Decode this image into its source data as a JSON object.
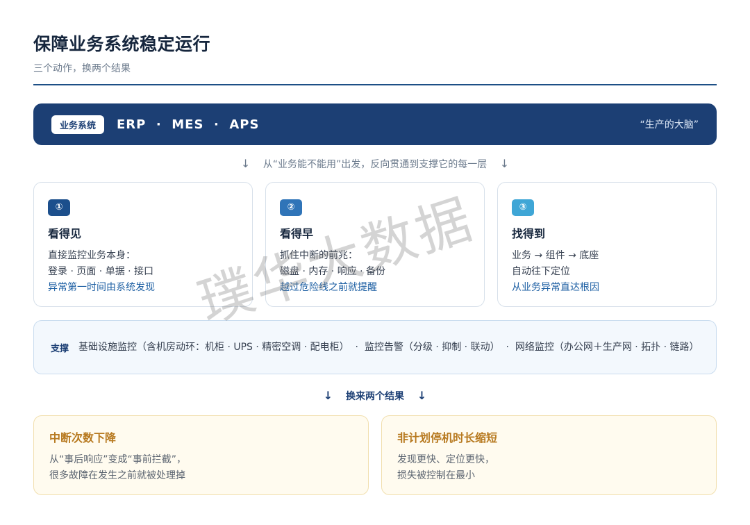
{
  "header": {
    "title": "保障业务系统稳定运行",
    "subtitle": "三个动作，换两个结果"
  },
  "banner": {
    "tag": "业务系统",
    "systems": "ERP  ·  MES  ·  APS",
    "quote": "“生产的大脑”"
  },
  "flow_top": {
    "arrow_left": "↓",
    "text": "从“业务能不能用”出发，反向贯通到支撑它的每一层",
    "arrow_right": "↓"
  },
  "cards": [
    {
      "badge": "①",
      "badge_color": "#1c4f8c",
      "title": "看得见",
      "line1": "直接监控业务本身：",
      "line2": "登录 · 页面 · 单据 · 接口",
      "line3": "异常第一时间由系统发现"
    },
    {
      "badge": "②",
      "badge_color": "#2f74b8",
      "title": "看得早",
      "line1": "抓住中断的前兆：",
      "line2": "磁盘 · 内存 · 响应 · 备份",
      "line3": "越过危险线之前就提醒"
    },
    {
      "badge": "③",
      "badge_color": "#3fa6d6",
      "title": "找得到",
      "line1": "业务 → 组件 → 底座",
      "line2": "自动往下定位",
      "line3": "从业务异常直达根因"
    }
  ],
  "support": {
    "label": "支撑",
    "text": "基础设施监控（含机房动环：机柜 · UPS · 精密空调 · 配电柜）  ·  监控告警（分级 · 抑制 · 联动）  ·  网络监控（办公网＋生产网 · 拓扑 · 链路）"
  },
  "flow_bottom": {
    "arrow_left": "↓",
    "text": "换来两个结果",
    "arrow_right": "↓"
  },
  "results": [
    {
      "title": "中断次数下降",
      "line1": "从“事后响应”变成“事前拦截”，",
      "line2": "很多故障在发生之前就被处理掉"
    },
    {
      "title": "非计划停机时长缩短",
      "line1": "发现更快、定位更快，",
      "line2": "损失被控制在最小"
    }
  ],
  "watermark": "璞华大数据"
}
